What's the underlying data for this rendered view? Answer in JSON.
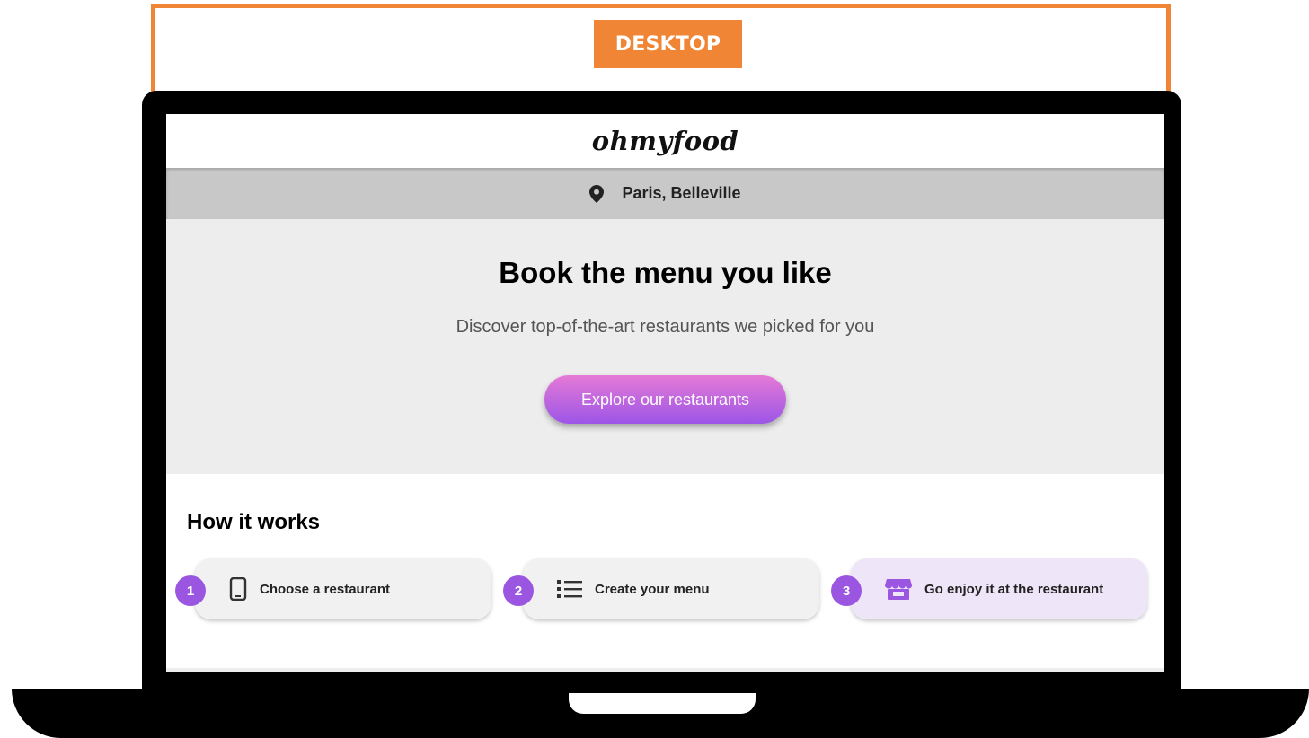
{
  "frame": {
    "badge": "DESKTOP"
  },
  "site": {
    "logo": "ohmyfood",
    "location": "Paris, Belleville"
  },
  "hero": {
    "title": "Book the menu you like",
    "subtitle": "Discover top-of-the-art restaurants we picked for you",
    "cta_label": "Explore our restaurants"
  },
  "how": {
    "title": "How it works",
    "steps": [
      {
        "number": "1",
        "label": "Choose a restaurant",
        "icon": "phone-icon"
      },
      {
        "number": "2",
        "label": "Create your menu",
        "icon": "list-icon"
      },
      {
        "number": "3",
        "label": "Go enjoy it at the restaurant",
        "icon": "store-icon"
      }
    ]
  },
  "colors": {
    "frame": "#ef8535",
    "accent": "#9a56e0",
    "cta_top": "#e57ad6",
    "cta_bottom": "#9c55e6"
  }
}
